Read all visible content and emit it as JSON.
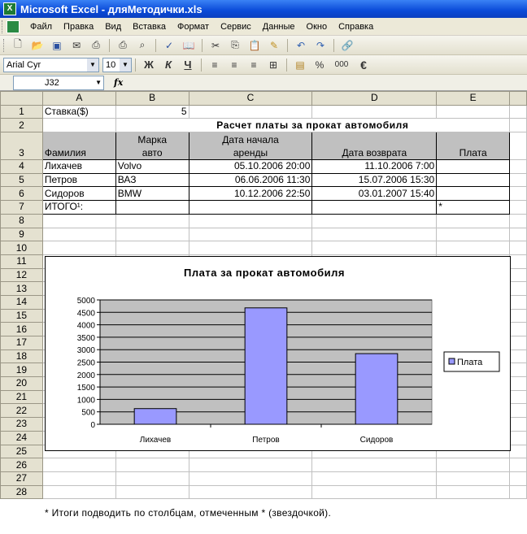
{
  "window": {
    "title": "Microsoft Excel - дляМетодички.xls",
    "app_icon": "X"
  },
  "menu": [
    "Файл",
    "Правка",
    "Вид",
    "Вставка",
    "Формат",
    "Сервис",
    "Данные",
    "Окно",
    "Справка"
  ],
  "toolbar": {
    "font_name": "Arial Cyr",
    "font_size": "10",
    "bold": "Ж",
    "italic": "К",
    "underline": "Ч",
    "percent": "%",
    "thousands": "000",
    "currency": "€"
  },
  "formula_bar": {
    "cell_ref": "J32",
    "fx": "fx"
  },
  "columns": [
    "A",
    "B",
    "C",
    "D",
    "E"
  ],
  "rows": [
    "1",
    "2",
    "3",
    "4",
    "5",
    "6",
    "7",
    "8",
    "9",
    "10",
    "11",
    "12",
    "13",
    "14",
    "15",
    "16",
    "17",
    "18",
    "19",
    "20",
    "21",
    "22",
    "23",
    "24",
    "25",
    "26",
    "27",
    "28"
  ],
  "cells": {
    "a1": "Ставка($)",
    "b1": "5",
    "title2": "Расчет платы за прокат автомобиля",
    "h_a": "Фамилия",
    "h_b1": "Марка",
    "h_b2": "авто",
    "h_c1": "Дата начала",
    "h_c2": "аренды",
    "h_d": "Дата возврата",
    "h_e": "Плата",
    "r4": [
      "Лихачев",
      "Volvo",
      "05.10.2006 20:00",
      "11.10.2006 7:00"
    ],
    "r5": [
      "Петров",
      "ВАЗ",
      "06.06.2006 11:30",
      "15.07.2006 15:30"
    ],
    "r6": [
      "Сидоров",
      "BMW",
      "10.12.2006 22:50",
      "03.01.2007 15:40"
    ],
    "r7_a": "ИТОГО¹:",
    "r7_e": "*"
  },
  "footnote": "*  Итоги подводить по столбцам, отмеченным * (звездочкой).",
  "chart_data": {
    "type": "bar",
    "title": "Плата за прокат автомобиля",
    "categories": [
      "Лихачев",
      "Петров",
      "Сидоров"
    ],
    "series": [
      {
        "name": "Плата",
        "values": [
          630,
          4680,
          2840
        ]
      }
    ],
    "ylim": [
      0,
      5000
    ],
    "yticks": [
      "0",
      "500",
      "1000",
      "1500",
      "2000",
      "2500",
      "3000",
      "3500",
      "4000",
      "4500",
      "5000"
    ],
    "grid": true,
    "legend": "right",
    "bar_color": "#9999ff",
    "plot_bg": "#c0c0c0"
  }
}
